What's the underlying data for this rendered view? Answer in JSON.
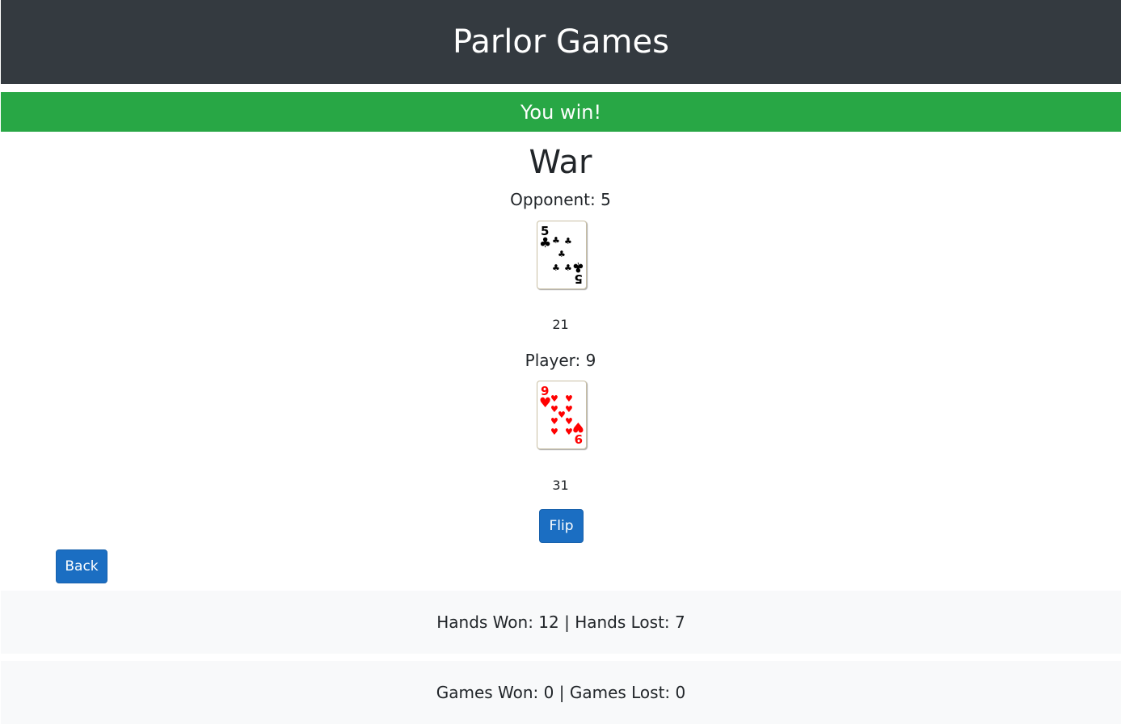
{
  "header": {
    "title": "Parlor Games"
  },
  "alert": {
    "message": "You win!"
  },
  "game": {
    "title": "War",
    "opponent": {
      "label": "Opponent: 5",
      "card": {
        "rank": "5",
        "suit": "clubs",
        "color": "#000000"
      },
      "count": "21"
    },
    "player": {
      "label": "Player: 9",
      "card": {
        "rank": "9",
        "suit": "hearts",
        "color": "#ff0000"
      },
      "count": "31"
    },
    "flip_label": "Flip"
  },
  "back_label": "Back",
  "stats": {
    "hands": "Hands Won: 12 | Hands Lost: 7",
    "games": "Games Won: 0 | Games Lost: 0"
  },
  "colors": {
    "header_bg": "#343a40",
    "alert_bg": "#28a745",
    "button_bg": "#1b6ec2",
    "footer_bg": "#f8f9fa"
  }
}
